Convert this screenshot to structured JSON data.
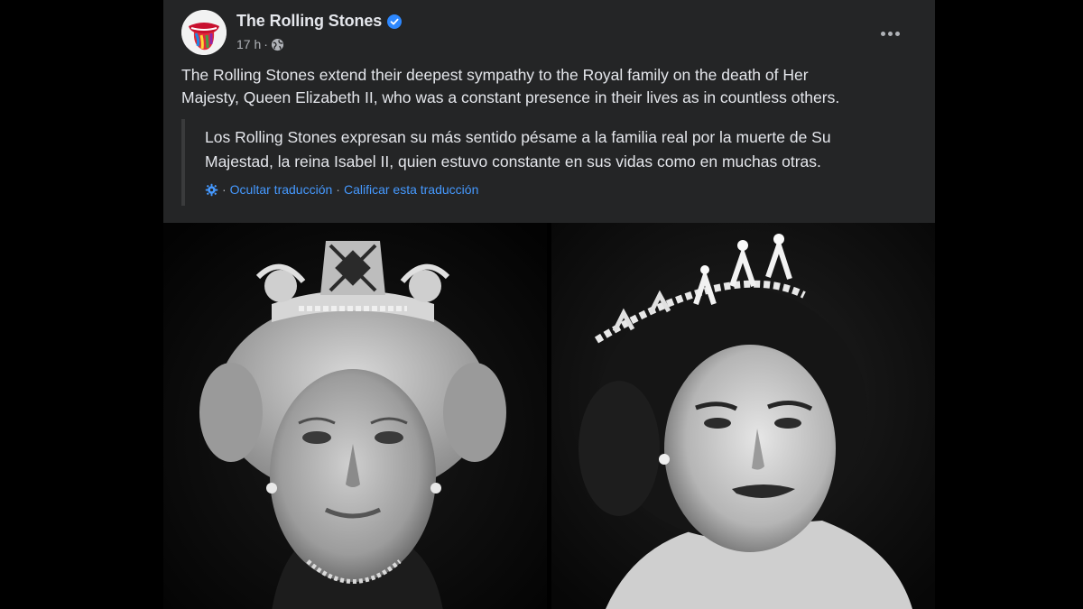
{
  "post": {
    "page_name": "The Rolling Stones",
    "verified_icon": "verified-badge-icon",
    "time": "17 h",
    "meta_separator": "·",
    "audience_icon": "globe-icon",
    "more_icon": "more-options-icon",
    "text_line1": "The Rolling Stones extend their deepest sympathy to the Royal family on the death of Her",
    "text_line2": "Majesty, Queen Elizabeth II, who was a constant presence in their lives as in countless others."
  },
  "translation": {
    "text_line1": "Los Rolling Stones expresan su más sentido pésame a la familia real por la muerte de Su",
    "text_line2": "Majestad, la reina Isabel II, quien estuvo constante en sus vidas como en muchas otras.",
    "separator": "·",
    "hide_label": "Ocultar traducción",
    "rate_label": "Calificar esta traducción",
    "settings_icon": "gear-icon"
  },
  "colors": {
    "background": "#000000",
    "card": "#242526",
    "primary_text": "#e4e6eb",
    "secondary_text": "#b0b3b8",
    "link": "#4599ff",
    "verified": "#2d88ff"
  }
}
